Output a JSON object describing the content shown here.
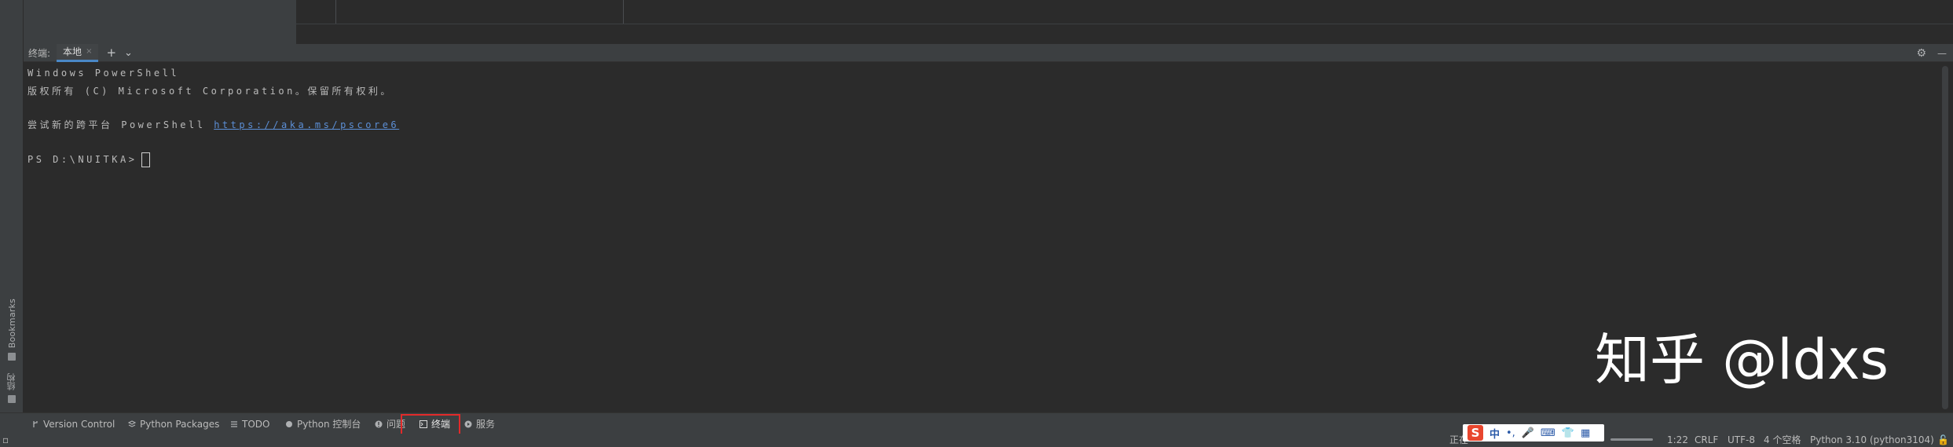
{
  "left_stripe": {
    "bookmarks_label": "Bookmarks",
    "structure_label": "结构"
  },
  "terminal": {
    "title": "终端:",
    "tab_label": "本地",
    "tab_close": "×",
    "add_button": "+",
    "dropdown_button": "⌄",
    "settings_icon": "⚙",
    "minimize_icon": "—",
    "lines": {
      "line1": "Windows PowerShell",
      "line2": "版权所有 (C) Microsoft Corporation。保留所有权利。",
      "line3_prefix": "尝试新的跨平台 PowerShell ",
      "line3_link": "https://aka.ms/pscore6",
      "prompt": "PS D:\\NUITKA>"
    }
  },
  "watermark": "知乎 @ldxs",
  "tool_tabs": {
    "version_control": "Version Control",
    "python_packages": "Python Packages",
    "todo": "TODO",
    "python_console": "Python 控制台",
    "problems": "问题",
    "terminal": "终端",
    "services": "服务"
  },
  "status_bar": {
    "ime_text": "正在",
    "ime_chars": "中",
    "position": "1:22",
    "line_sep": "CRLF",
    "encoding": "UTF-8",
    "indent": "4 个空格",
    "interpreter": "Python 3.10 (python3104)"
  },
  "colors": {
    "accent": "#4a88c7",
    "highlight_box": "#e22a2a",
    "link": "#5c8fd6",
    "ime_logo": "#e8462e"
  }
}
